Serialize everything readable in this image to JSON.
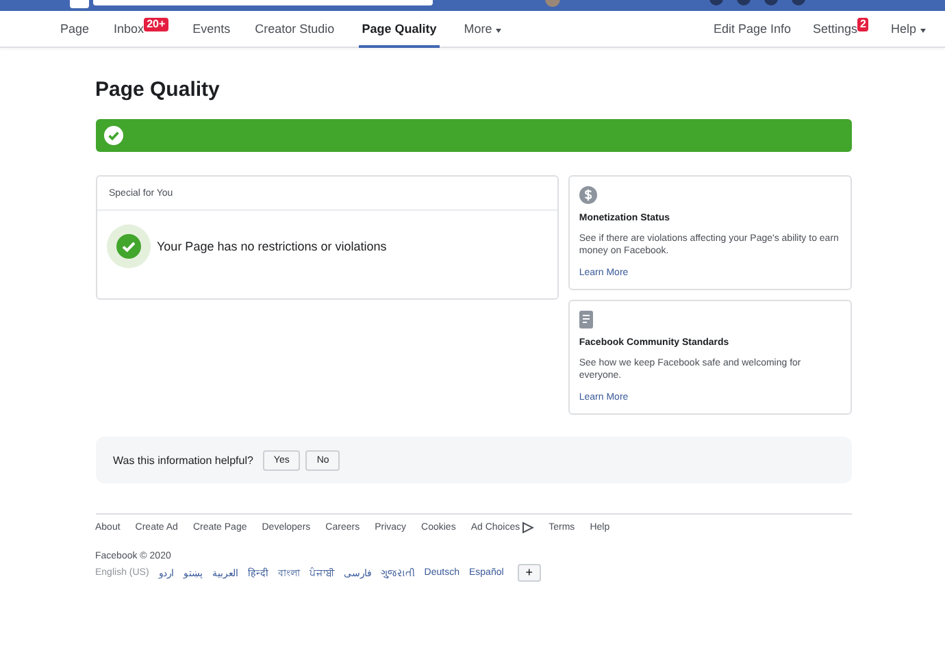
{
  "nav": {
    "left": [
      {
        "label": "Page",
        "selected": false
      },
      {
        "label": "Inbox",
        "badge": "20+",
        "selected": false
      },
      {
        "label": "Events",
        "selected": false
      },
      {
        "label": "Creator Studio",
        "selected": false
      },
      {
        "label": "Page Quality",
        "selected": true
      },
      {
        "label": "More",
        "dropdown": true,
        "selected": false
      }
    ],
    "right": [
      {
        "label": "Edit Page Info"
      },
      {
        "label": "Settings",
        "badge": "2"
      },
      {
        "label": "Help",
        "dropdown": true
      }
    ]
  },
  "title": "Page Quality",
  "status_banner": {
    "ok": true
  },
  "special": {
    "heading": "Special for You",
    "message": "Your Page has no restrictions or violations"
  },
  "side_cards": [
    {
      "kind": "money",
      "title": "Monetization Status",
      "text": "See if there are violations affecting your Page's ability to earn money on Facebook.",
      "link": "Learn More"
    },
    {
      "kind": "document",
      "title": "Facebook Community Standards",
      "text": "See how we keep Facebook safe and welcoming for everyone.",
      "link": "Learn More"
    }
  ],
  "feedback": {
    "question": "Was this information helpful?",
    "buttons": [
      "Yes",
      "No"
    ]
  },
  "footer": {
    "links": [
      "About",
      "Create Ad",
      "Create Page",
      "Developers",
      "Careers",
      "Privacy",
      "Cookies",
      "Ad Choices",
      "Terms",
      "Help"
    ],
    "copyright": "Facebook © 2020",
    "current_language": "English (US)",
    "languages": [
      "اردو",
      "پښتو",
      "العربية",
      "हिन्दी",
      "বাংলা",
      "ਪੰਜਾਬੀ",
      "فارسی",
      "ગુજરાતી",
      "Deutsch",
      "Español"
    ],
    "more_button": "+"
  }
}
